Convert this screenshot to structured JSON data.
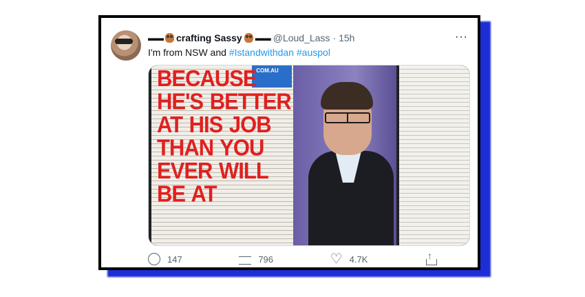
{
  "tweet": {
    "display_name": "crafting Sassy",
    "name_prefix_icons": [
      "sunglasses-icon",
      "owl-icon"
    ],
    "name_suffix_icons": [
      "owl-icon",
      "sunglasses-icon"
    ],
    "handle": "@Loud_Lass",
    "separator": "·",
    "time": "15h",
    "more_label": "···",
    "text_prefix": "I'm from NSW and ",
    "hashtag1": "#Istandwithdan",
    "hashtag2": "#auspol"
  },
  "media": {
    "headline": "BECAUSE HE'S BETTER AT HIS JOB THAN YOU EVER WILL BE AT",
    "masthead": ".COM.AU"
  },
  "actions": {
    "replies": "147",
    "retweets": "796",
    "likes": "4.7K"
  },
  "colors": {
    "shadow": "#1d2ed6",
    "hashtag": "#1d9bf0",
    "headline": "#e0201f"
  }
}
